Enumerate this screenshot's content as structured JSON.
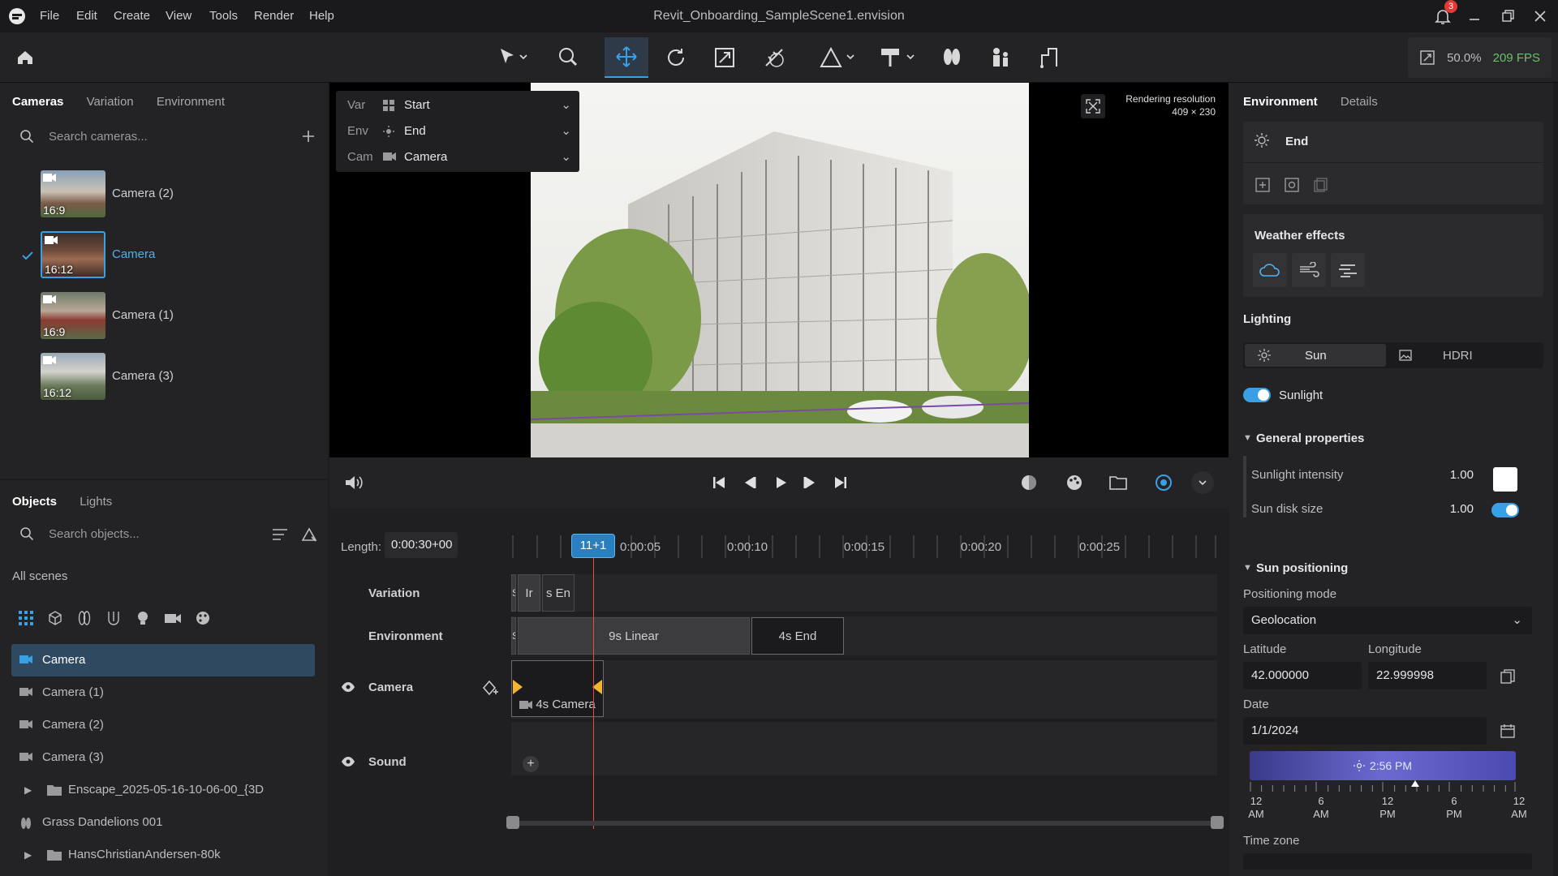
{
  "window": {
    "title": "Revit_Onboarding_SampleScene1.envision",
    "notification_count": "3"
  },
  "menu": [
    "File",
    "Edit",
    "Create",
    "View",
    "Tools",
    "Render",
    "Help"
  ],
  "stats": {
    "zoom": "50.0%",
    "fps": "209 FPS"
  },
  "left_top": {
    "tabs": [
      "Cameras",
      "Variation",
      "Environment"
    ],
    "search_placeholder": "Search cameras...",
    "cameras": [
      {
        "label": "Camera (2)",
        "ratio": "16:9",
        "selected": false
      },
      {
        "label": "Camera",
        "ratio": "16:12",
        "selected": true
      },
      {
        "label": "Camera (1)",
        "ratio": "16:9",
        "selected": false
      },
      {
        "label": "Camera (3)",
        "ratio": "16:12",
        "selected": false
      }
    ]
  },
  "left_bottom": {
    "tabs": [
      "Objects",
      "Lights"
    ],
    "search_placeholder": "Search objects...",
    "scope": "All scenes",
    "objects": [
      {
        "label": "Camera",
        "icon": "camera-icon",
        "selected": true
      },
      {
        "label": "Camera (1)",
        "icon": "camera-icon",
        "selected": false
      },
      {
        "label": "Camera (2)",
        "icon": "camera-icon",
        "selected": false
      },
      {
        "label": "Camera (3)",
        "icon": "camera-icon",
        "selected": false
      },
      {
        "label": "Enscape_2025-05-16-10-06-00_{3D",
        "icon": "folder-icon",
        "selected": false,
        "expandable": true
      },
      {
        "label": "Grass Dandelions 001",
        "icon": "grass-icon",
        "selected": false
      },
      {
        "label": "HansChristianAndersen-80k",
        "icon": "folder-icon",
        "selected": false,
        "expandable": true
      }
    ]
  },
  "viewport": {
    "var_key": "Var",
    "var_value": "Start",
    "env_key": "Env",
    "env_value": "End",
    "cam_key": "Cam",
    "cam_value": "Camera",
    "res_title": "Rendering resolution",
    "res_value": "409 × 230"
  },
  "timeline": {
    "length_label": "Length:",
    "length_value": "0:00:30+00",
    "playhead": "11+1",
    "ticks": [
      "0:00:05",
      "0:00:10",
      "0:00:15",
      "0:00:20",
      "0:00:25"
    ],
    "tracks": [
      "Variation",
      "Environment",
      "Camera",
      "Sound"
    ],
    "variation_clips": [
      "S",
      "Ir",
      "s En"
    ],
    "environment_clips": [
      "S",
      "9s Linear",
      "4s End"
    ],
    "camera_clip": "4s Camera"
  },
  "right": {
    "tabs": [
      "Environment",
      "Details"
    ],
    "env_name": "End",
    "weather_title": "Weather effects",
    "lighting_title": "Lighting",
    "sun_tab": "Sun",
    "hdri_tab": "HDRI",
    "sunlight_label": "Sunlight",
    "general_title": "General properties",
    "intensity_label": "Sunlight intensity",
    "intensity_value": "1.00",
    "disk_label": "Sun disk size",
    "disk_value": "1.00",
    "sunpos_title": "Sun positioning",
    "mode_label": "Positioning mode",
    "mode_value": "Geolocation",
    "lat_label": "Latitude",
    "lat_value": "42.000000",
    "lon_label": "Longitude",
    "lon_value": "22.999998",
    "date_label": "Date",
    "date_value": "1/1/2024",
    "time_value": "2:56 PM",
    "time_fraction": 0.622,
    "time_scale": [
      {
        "h": "12",
        "p": "AM"
      },
      {
        "h": "6",
        "p": "AM"
      },
      {
        "h": "12",
        "p": "PM"
      },
      {
        "h": "6",
        "p": "PM"
      },
      {
        "h": "12",
        "p": "AM"
      }
    ],
    "tz_label": "Time zone"
  },
  "colors": {
    "accent": "#3aa0e6",
    "selection": "#2f4a60",
    "fps_green": "#67c36b",
    "notification": "#e53935"
  }
}
